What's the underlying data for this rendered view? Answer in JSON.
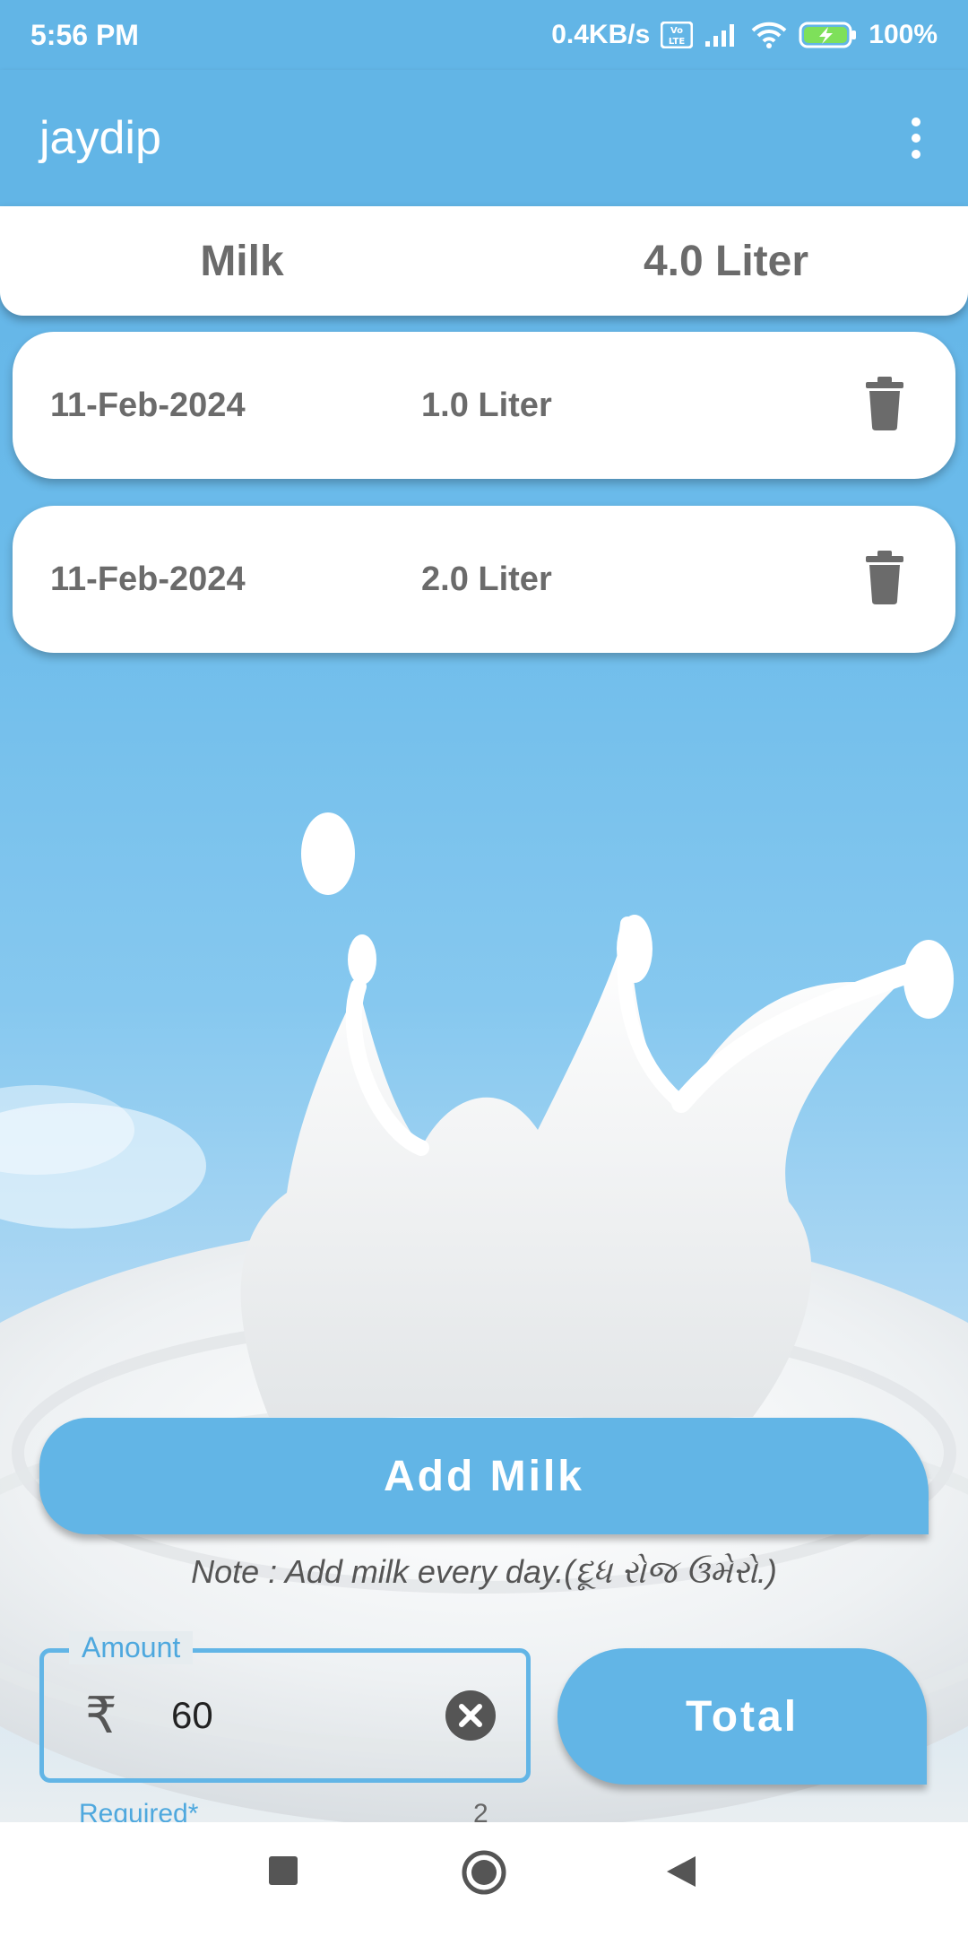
{
  "status_bar": {
    "time": "5:56 PM",
    "network_speed": "0.4KB/s",
    "battery": "100%",
    "icons": [
      "volte-icon",
      "signal-icon",
      "wifi-icon",
      "battery-charging-icon"
    ]
  },
  "app_bar": {
    "title": "jaydip",
    "menu_icon": "overflow-menu-icon"
  },
  "summary": {
    "label": "Milk",
    "total": "4.0 Liter"
  },
  "entries": [
    {
      "date": "11-Feb-2024",
      "quantity": "1.0 Liter",
      "action_icon": "trash-icon"
    },
    {
      "date": "11-Feb-2024",
      "quantity": "2.0 Liter",
      "action_icon": "trash-icon"
    }
  ],
  "add_button": {
    "label": "Add Milk"
  },
  "note": "Note : Add milk every day.(દૂધ રોજ ઉમેરો.)",
  "amount_field": {
    "label": "Amount",
    "prefix": "₹",
    "value": "60",
    "helper": "Required*",
    "counter": "2",
    "clear_icon": "clear-icon"
  },
  "total_button": {
    "label": "Total"
  },
  "nav_bar": {
    "icons": [
      "recents-square-icon",
      "home-circle-icon",
      "back-triangle-icon"
    ]
  },
  "colors": {
    "primary": "#62b5e6",
    "card": "#ffffff",
    "text": "#6b6b6b"
  }
}
